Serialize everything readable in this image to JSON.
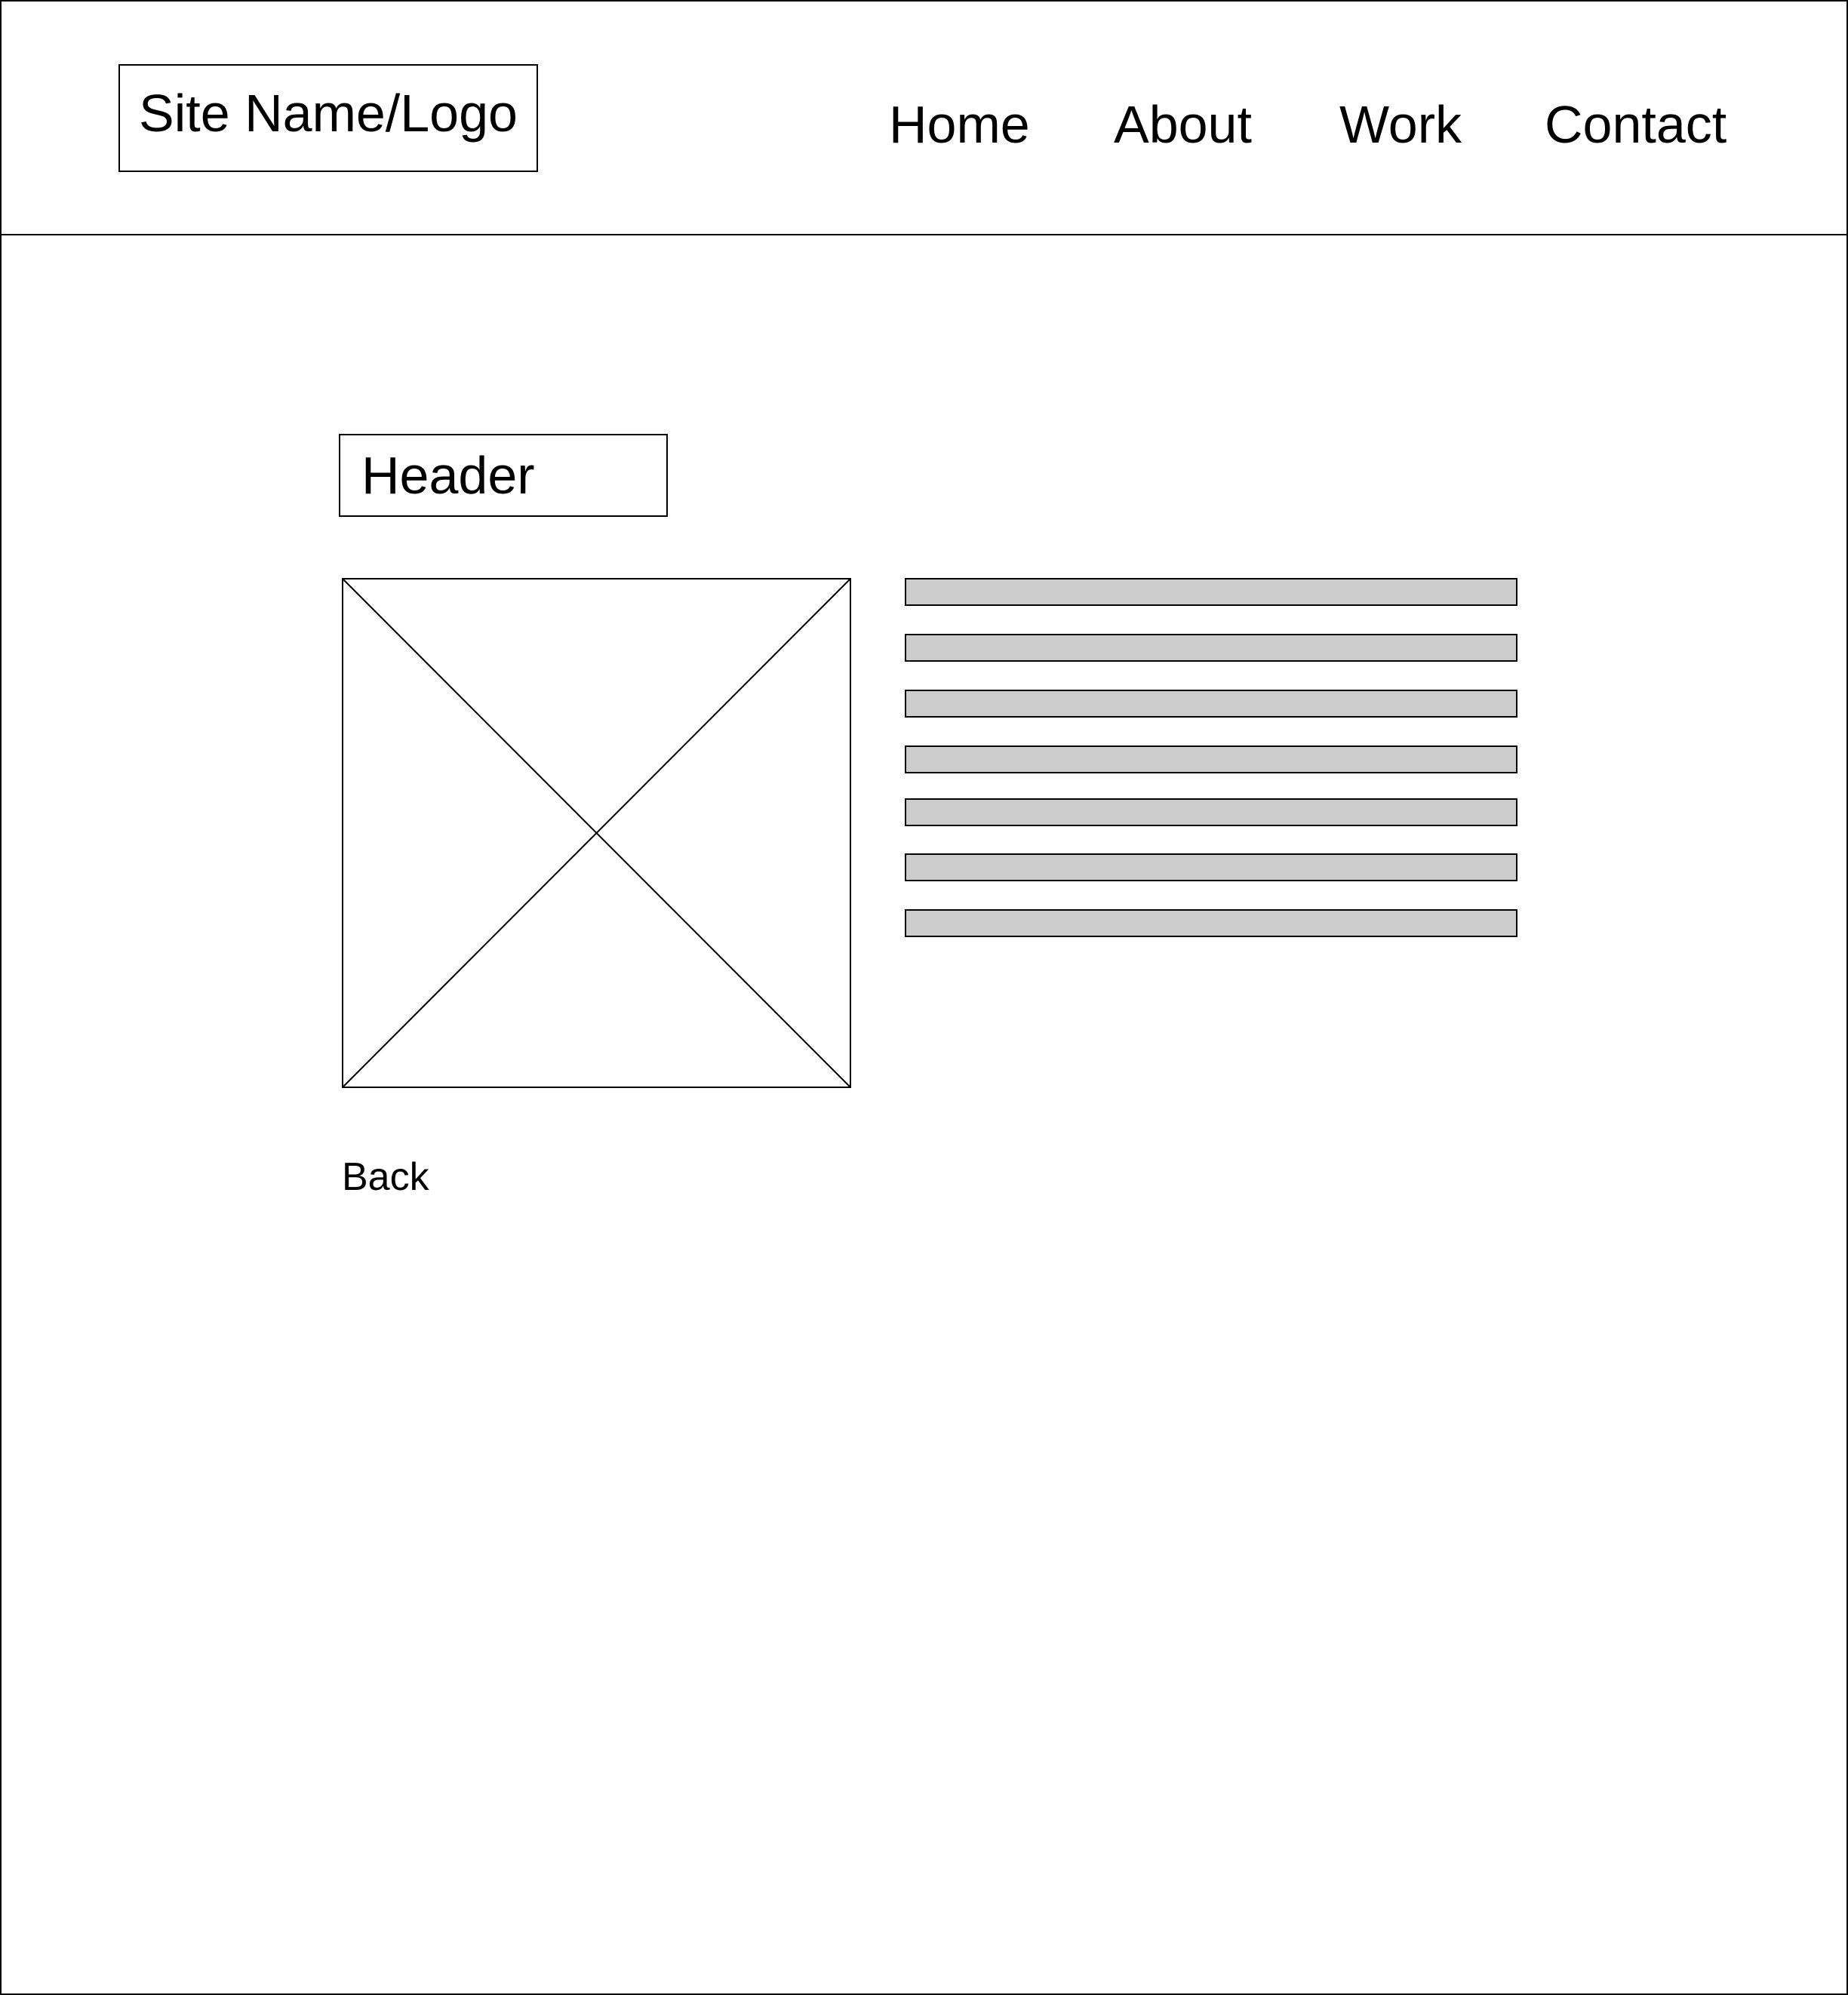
{
  "header": {
    "logo_text": "Site Name/Logo",
    "nav": {
      "home": "Home",
      "about": "About",
      "work": "Work",
      "contact": "Contact"
    }
  },
  "main": {
    "header_text": "Header",
    "image_icon": "image-placeholder-icon",
    "text_line_count": 7,
    "text_line_fill": "#cccccc",
    "back_label": "Back"
  }
}
